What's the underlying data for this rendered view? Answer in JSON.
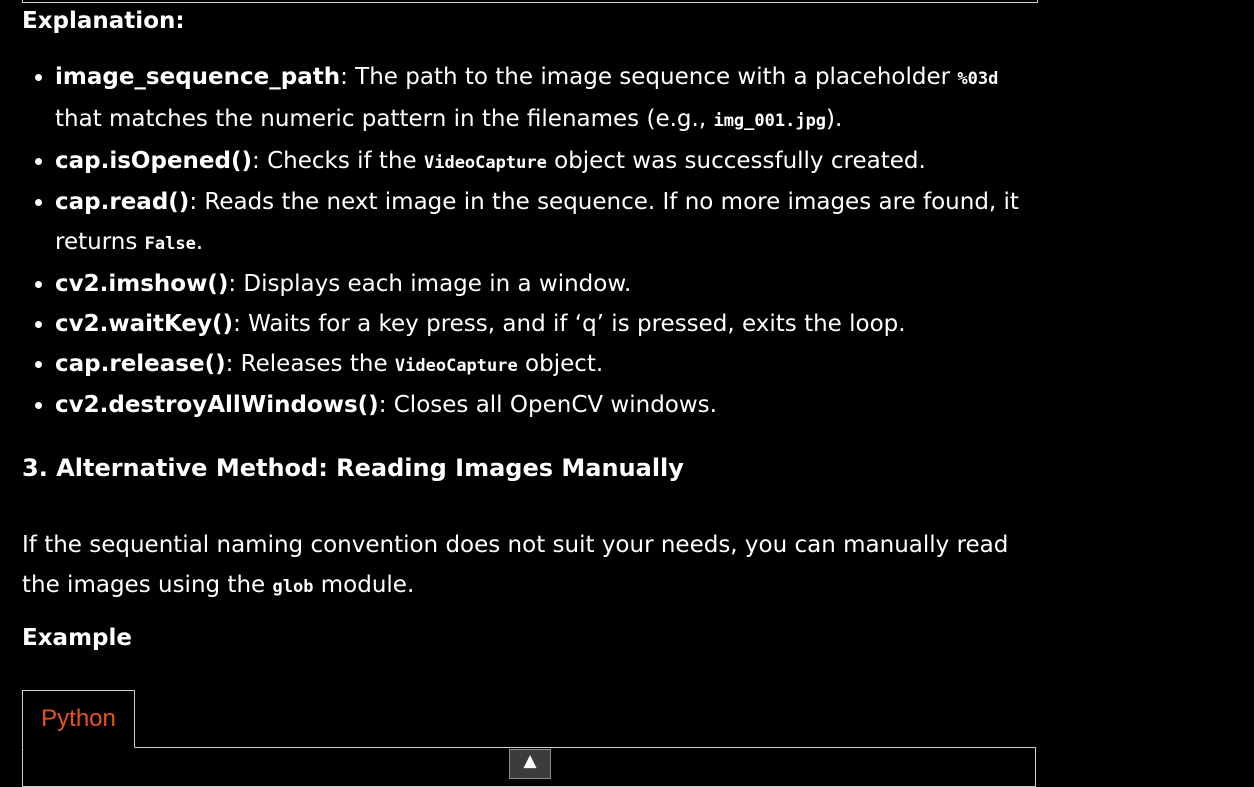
{
  "explanation": {
    "heading": "Explanation:",
    "items": [
      {
        "term": "image_sequence_path",
        "text1": ": The path to the image sequence with a placeholder ",
        "code1": "%03d",
        "text2": " that matches the numeric pattern in the filenames (e.g., ",
        "code2": "img_001.jpg",
        "text3": ")."
      },
      {
        "term": "cap.isOpened()",
        "text1": ": Checks if the ",
        "code1": "VideoCapture",
        "text2": " object was successfully created."
      },
      {
        "term": "cap.read()",
        "text1": ": Reads the next image in the sequence. If no more images are found, it returns ",
        "code1": "False",
        "text2": "."
      },
      {
        "term": "cv2.imshow()",
        "text1": ": Displays each image in a window."
      },
      {
        "term": "cv2.waitKey()",
        "text1": ": Waits for a key press, and if ‘q’ is pressed, exits the loop."
      },
      {
        "term": "cap.release()",
        "text1": ": Releases the ",
        "code1": "VideoCapture",
        "text2": " object."
      },
      {
        "term": "cv2.destroyAllWindows()",
        "text1": ": Closes all OpenCV windows."
      }
    ]
  },
  "section3": {
    "heading": "3. Alternative Method: Reading Images Manually",
    "paragraph": {
      "text1": "If the sequential naming convention does not suit your needs, you can manually read the images using the ",
      "code1": "glob",
      "text2": " module."
    },
    "example_heading": "Example"
  },
  "code_tabs": {
    "active_tab": "Python",
    "active_color": "#e8531f"
  },
  "scroll_button": {
    "glyph": "▲"
  }
}
